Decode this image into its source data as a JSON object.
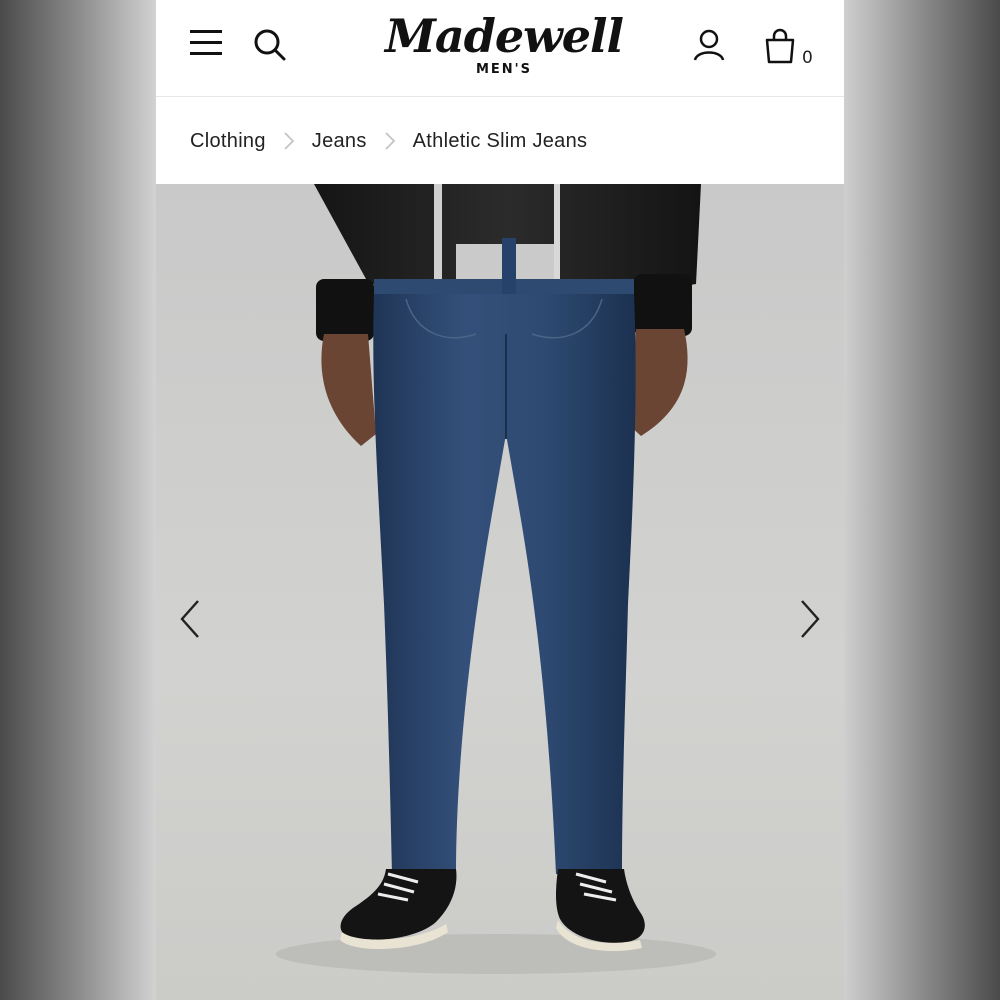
{
  "header": {
    "logo_script": "Madewell",
    "logo_sub": "MEN'S",
    "bag_count": "0"
  },
  "icons": {
    "menu": "hamburger-menu-icon",
    "search": "search-icon",
    "account": "account-icon",
    "bag": "shopping-bag-icon",
    "prev": "chevron-left-icon",
    "next": "chevron-right-icon"
  },
  "breadcrumb": {
    "items": [
      "Clothing",
      "Jeans",
      "Athletic Slim Jeans"
    ]
  },
  "colors": {
    "text": "#222222",
    "background": "#ffffff",
    "photo_background": "#cfcfcd",
    "denim": "#2c4669"
  }
}
